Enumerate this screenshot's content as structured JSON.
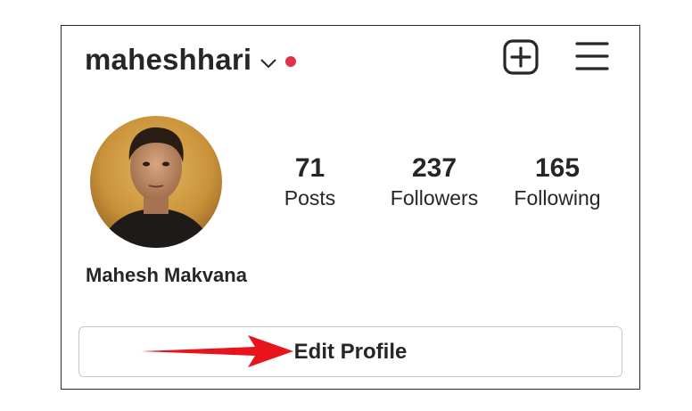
{
  "header": {
    "username": "maheshhari",
    "notification_dot_color": "#e0334a"
  },
  "icons": {
    "new_post": "plus-square-icon",
    "menu": "hamburger-menu-icon",
    "account_switch": "chevron-down-icon"
  },
  "stats": [
    {
      "value": "71",
      "label": "Posts"
    },
    {
      "value": "237",
      "label": "Followers"
    },
    {
      "value": "165",
      "label": "Following"
    }
  ],
  "profile": {
    "display_name": "Mahesh Makvana"
  },
  "actions": {
    "edit_profile_label": "Edit Profile"
  },
  "annotation": {
    "arrow_color": "#e8141c"
  }
}
